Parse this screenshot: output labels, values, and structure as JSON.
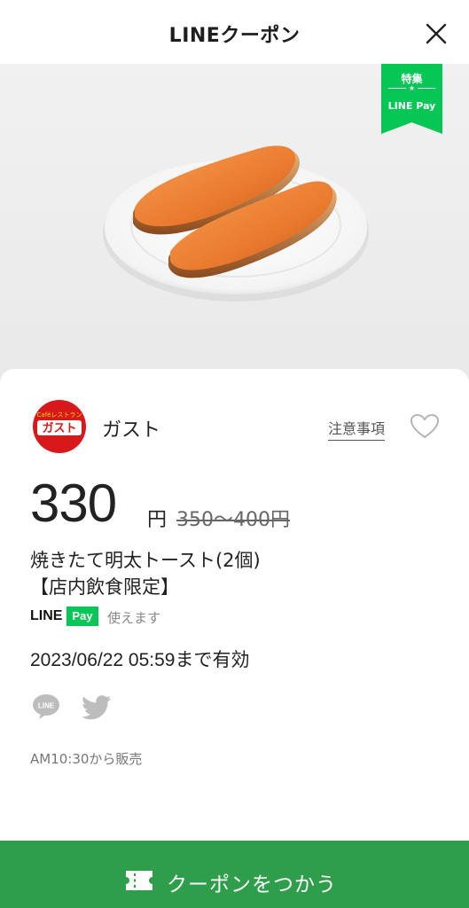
{
  "header": {
    "title": "LINEクーポン"
  },
  "hero": {
    "tag_line1": "特集",
    "tag_star": "★",
    "tag_line2": "LINE Pay"
  },
  "shop": {
    "logo_text_top": "Caféレストラン",
    "logo_text_main": "ガスト",
    "name": "ガスト",
    "caution_label": "注意事項"
  },
  "coupon": {
    "price": "330",
    "price_unit": "円",
    "original_price": "350～400円",
    "description_line1": "焼きたて明太トースト(2個)",
    "description_line2": "【店内飲食限定】",
    "linepay_logo": "LINE",
    "linepay_badge": "Pay",
    "linepay_available": "使えます",
    "valid_until": "2023/06/22  05:59まで有効",
    "sales_start": "AM10:30から販売"
  },
  "share": {
    "line_icon_text": "LINE"
  },
  "action": {
    "use_label": "クーポンをつかう"
  },
  "colors": {
    "line_green": "#06c755",
    "button_green": "#2e9e4a",
    "logo_red": "#d7191c"
  }
}
